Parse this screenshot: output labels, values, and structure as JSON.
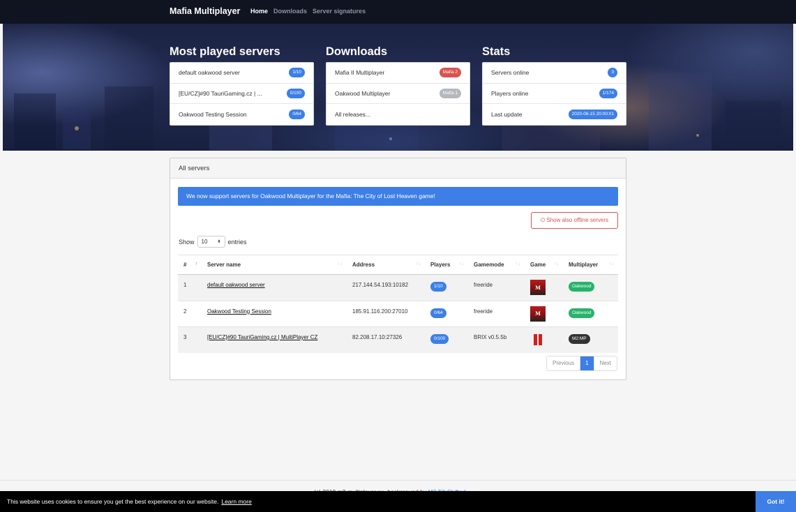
{
  "nav": {
    "brand": "Mafia Multiplayer",
    "links": [
      "Home",
      "Downloads",
      "Server signatures"
    ]
  },
  "hero": {
    "most_played": {
      "title": "Most played servers",
      "rows": [
        {
          "label": "default oakwood server",
          "badge": "1/10"
        },
        {
          "label": "[EU/CZ]#90 TauriGaming.cz | ...",
          "badge": "0/100"
        },
        {
          "label": "Oakwood Testing Session",
          "badge": "0/64"
        }
      ]
    },
    "downloads": {
      "title": "Downloads",
      "rows": [
        {
          "label": "Mafia II Multiplayer",
          "badge": "Mafia 2"
        },
        {
          "label": "Oakwood Multiplayer",
          "badge": "Mafia 1"
        },
        {
          "label": "All releases...",
          "badge": ""
        }
      ]
    },
    "stats": {
      "title": "Stats",
      "rows": [
        {
          "label": "Servers online",
          "badge": "3"
        },
        {
          "label": "Players online",
          "badge": "1/174"
        },
        {
          "label": "Last update",
          "badge": "2020-06-15 20:00:01"
        }
      ]
    }
  },
  "panel": {
    "heading": "All servers",
    "alert": "We now support servers for Oakwood Multiplayer for the Mafia: The City of Lost Heaven game!",
    "offline_button": "Show also offline servers",
    "show_label": "Show",
    "entries_label": "entries",
    "length_value": "10",
    "columns": [
      "#",
      "Server name",
      "Address",
      "Players",
      "Gamemode",
      "Game",
      "Multiplayer"
    ],
    "rows": [
      {
        "num": "1",
        "name": "default oakwood server",
        "address": "217.144.54.193:10182",
        "players": "1/10",
        "gamemode": "freeride",
        "game": "mafia-logo",
        "mp": "Oakwood"
      },
      {
        "num": "2",
        "name": "Oakwood Testing Session",
        "address": "185.91.116.200:27010",
        "players": "0/64",
        "gamemode": "freeride",
        "game": "mafia-logo",
        "mp": "Oakwood"
      },
      {
        "num": "3",
        "name": "[EU/CZ]#90 TauriGaming.cz | MultiPlayer CZ",
        "address": "82.208.17.10:27326",
        "players": "0/100",
        "gamemode": "BRIX v0.5.5b",
        "game": "mafia2-logo",
        "mp": "M2:MP"
      }
    ],
    "pager": {
      "prev": "Previous",
      "current": "1",
      "next": "Next"
    }
  },
  "footer": {
    "text": "(c) 2019 m2-multiplayer.eu, background by ",
    "link": "M2 Tilt Shifted"
  },
  "cookie": {
    "message": "This website uses cookies to ensure you get the best experience on our website.",
    "learn_more": "Learn more",
    "button": "Got it!"
  },
  "colors": {
    "accent": "#3d7fe6",
    "danger": "#d9534f",
    "success": "#27b36a",
    "navbar": "#101320"
  }
}
